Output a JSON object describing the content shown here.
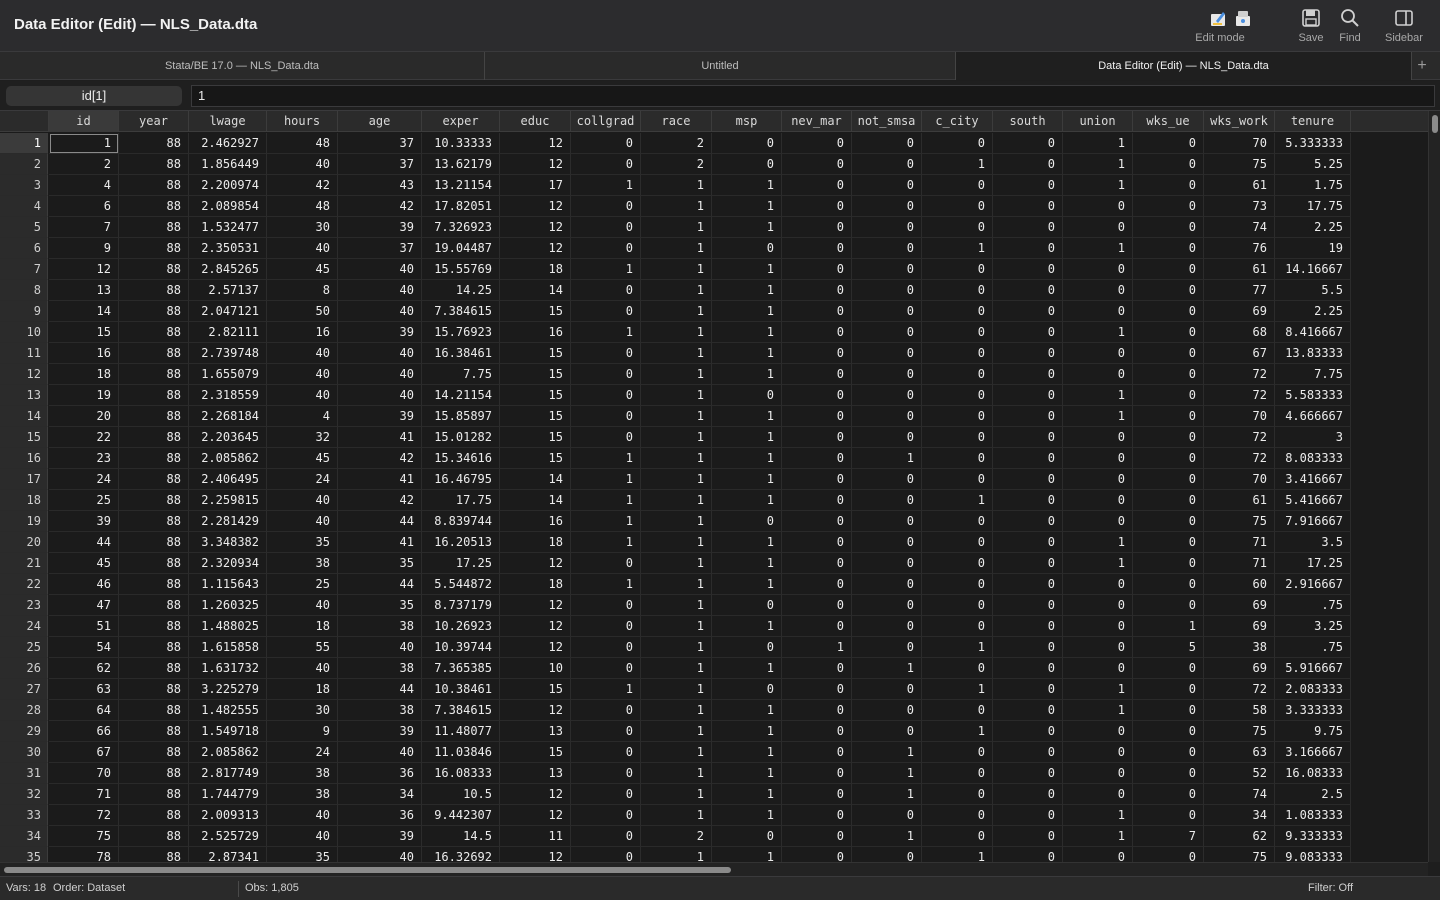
{
  "window": {
    "title": "Data Editor (Edit) — NLS_Data.dta"
  },
  "toolbar": {
    "edit_mode": "Edit mode",
    "save": "Save",
    "find": "Find",
    "sidebar": "Sidebar"
  },
  "tabs": [
    {
      "label": "Stata/BE 17.0 — NLS_Data.dta"
    },
    {
      "label": "Untitled"
    },
    {
      "label": "Data Editor (Edit) — NLS_Data.dta"
    }
  ],
  "add_tab": "+",
  "cellbar": {
    "ref": "id[1]",
    "value": "1"
  },
  "columns": [
    "id",
    "year",
    "lwage",
    "hours",
    "age",
    "exper",
    "educ",
    "collgrad",
    "race",
    "msp",
    "nev_mar",
    "not_smsa",
    "c_city",
    "south",
    "union",
    "wks_ue",
    "wks_work",
    "tenure"
  ],
  "rows": [
    [
      "1",
      "88",
      "2.462927",
      "48",
      "37",
      "10.33333",
      "12",
      "0",
      "2",
      "0",
      "0",
      "0",
      "0",
      "0",
      "1",
      "0",
      "70",
      "5.333333"
    ],
    [
      "2",
      "88",
      "1.856449",
      "40",
      "37",
      "13.62179",
      "12",
      "0",
      "2",
      "0",
      "0",
      "0",
      "1",
      "0",
      "1",
      "0",
      "75",
      "5.25"
    ],
    [
      "4",
      "88",
      "2.200974",
      "42",
      "43",
      "13.21154",
      "17",
      "1",
      "1",
      "1",
      "0",
      "0",
      "0",
      "0",
      "1",
      "0",
      "61",
      "1.75"
    ],
    [
      "6",
      "88",
      "2.089854",
      "48",
      "42",
      "17.82051",
      "12",
      "0",
      "1",
      "1",
      "0",
      "0",
      "0",
      "0",
      "0",
      "0",
      "73",
      "17.75"
    ],
    [
      "7",
      "88",
      "1.532477",
      "30",
      "39",
      "7.326923",
      "12",
      "0",
      "1",
      "1",
      "0",
      "0",
      "0",
      "0",
      "0",
      "0",
      "74",
      "2.25"
    ],
    [
      "9",
      "88",
      "2.350531",
      "40",
      "37",
      "19.04487",
      "12",
      "0",
      "1",
      "0",
      "0",
      "0",
      "1",
      "0",
      "1",
      "0",
      "76",
      "19"
    ],
    [
      "12",
      "88",
      "2.845265",
      "45",
      "40",
      "15.55769",
      "18",
      "1",
      "1",
      "1",
      "0",
      "0",
      "0",
      "0",
      "0",
      "0",
      "61",
      "14.16667"
    ],
    [
      "13",
      "88",
      "2.57137",
      "8",
      "40",
      "14.25",
      "14",
      "0",
      "1",
      "1",
      "0",
      "0",
      "0",
      "0",
      "0",
      "0",
      "77",
      "5.5"
    ],
    [
      "14",
      "88",
      "2.047121",
      "50",
      "40",
      "7.384615",
      "15",
      "0",
      "1",
      "1",
      "0",
      "0",
      "0",
      "0",
      "0",
      "0",
      "69",
      "2.25"
    ],
    [
      "15",
      "88",
      "2.82111",
      "16",
      "39",
      "15.76923",
      "16",
      "1",
      "1",
      "1",
      "0",
      "0",
      "0",
      "0",
      "1",
      "0",
      "68",
      "8.416667"
    ],
    [
      "16",
      "88",
      "2.739748",
      "40",
      "40",
      "16.38461",
      "15",
      "0",
      "1",
      "1",
      "0",
      "0",
      "0",
      "0",
      "0",
      "0",
      "67",
      "13.83333"
    ],
    [
      "18",
      "88",
      "1.655079",
      "40",
      "40",
      "7.75",
      "15",
      "0",
      "1",
      "1",
      "0",
      "0",
      "0",
      "0",
      "0",
      "0",
      "72",
      "7.75"
    ],
    [
      "19",
      "88",
      "2.318559",
      "40",
      "40",
      "14.21154",
      "15",
      "0",
      "1",
      "0",
      "0",
      "0",
      "0",
      "0",
      "1",
      "0",
      "72",
      "5.583333"
    ],
    [
      "20",
      "88",
      "2.268184",
      "4",
      "39",
      "15.85897",
      "15",
      "0",
      "1",
      "1",
      "0",
      "0",
      "0",
      "0",
      "1",
      "0",
      "70",
      "4.666667"
    ],
    [
      "22",
      "88",
      "2.203645",
      "32",
      "41",
      "15.01282",
      "15",
      "0",
      "1",
      "1",
      "0",
      "0",
      "0",
      "0",
      "0",
      "0",
      "72",
      "3"
    ],
    [
      "23",
      "88",
      "2.085862",
      "45",
      "42",
      "15.34616",
      "15",
      "1",
      "1",
      "1",
      "0",
      "1",
      "0",
      "0",
      "0",
      "0",
      "72",
      "8.083333"
    ],
    [
      "24",
      "88",
      "2.406495",
      "24",
      "41",
      "16.46795",
      "14",
      "1",
      "1",
      "1",
      "0",
      "0",
      "0",
      "0",
      "0",
      "0",
      "70",
      "3.416667"
    ],
    [
      "25",
      "88",
      "2.259815",
      "40",
      "42",
      "17.75",
      "14",
      "1",
      "1",
      "1",
      "0",
      "0",
      "1",
      "0",
      "0",
      "0",
      "61",
      "5.416667"
    ],
    [
      "39",
      "88",
      "2.281429",
      "40",
      "44",
      "8.839744",
      "16",
      "1",
      "1",
      "0",
      "0",
      "0",
      "0",
      "0",
      "0",
      "0",
      "75",
      "7.916667"
    ],
    [
      "44",
      "88",
      "3.348382",
      "35",
      "41",
      "16.20513",
      "18",
      "1",
      "1",
      "1",
      "0",
      "0",
      "0",
      "0",
      "1",
      "0",
      "71",
      "3.5"
    ],
    [
      "45",
      "88",
      "2.320934",
      "38",
      "35",
      "17.25",
      "12",
      "0",
      "1",
      "1",
      "0",
      "0",
      "0",
      "0",
      "1",
      "0",
      "71",
      "17.25"
    ],
    [
      "46",
      "88",
      "1.115643",
      "25",
      "44",
      "5.544872",
      "18",
      "1",
      "1",
      "1",
      "0",
      "0",
      "0",
      "0",
      "0",
      "0",
      "60",
      "2.916667"
    ],
    [
      "47",
      "88",
      "1.260325",
      "40",
      "35",
      "8.737179",
      "12",
      "0",
      "1",
      "0",
      "0",
      "0",
      "0",
      "0",
      "0",
      "0",
      "69",
      ".75"
    ],
    [
      "51",
      "88",
      "1.488025",
      "18",
      "38",
      "10.26923",
      "12",
      "0",
      "1",
      "1",
      "0",
      "0",
      "0",
      "0",
      "0",
      "1",
      "69",
      "3.25"
    ],
    [
      "54",
      "88",
      "1.615858",
      "55",
      "40",
      "10.39744",
      "12",
      "0",
      "1",
      "0",
      "1",
      "0",
      "1",
      "0",
      "0",
      "5",
      "38",
      ".75"
    ],
    [
      "62",
      "88",
      "1.631732",
      "40",
      "38",
      "7.365385",
      "10",
      "0",
      "1",
      "1",
      "0",
      "1",
      "0",
      "0",
      "0",
      "0",
      "69",
      "5.916667"
    ],
    [
      "63",
      "88",
      "3.225279",
      "18",
      "44",
      "10.38461",
      "15",
      "1",
      "1",
      "0",
      "0",
      "0",
      "1",
      "0",
      "1",
      "0",
      "72",
      "2.083333"
    ],
    [
      "64",
      "88",
      "1.482555",
      "30",
      "38",
      "7.384615",
      "12",
      "0",
      "1",
      "1",
      "0",
      "0",
      "0",
      "0",
      "1",
      "0",
      "58",
      "3.333333"
    ],
    [
      "66",
      "88",
      "1.549718",
      "9",
      "39",
      "11.48077",
      "13",
      "0",
      "1",
      "1",
      "0",
      "0",
      "1",
      "0",
      "0",
      "0",
      "75",
      "9.75"
    ],
    [
      "67",
      "88",
      "2.085862",
      "24",
      "40",
      "11.03846",
      "15",
      "0",
      "1",
      "1",
      "0",
      "1",
      "0",
      "0",
      "0",
      "0",
      "63",
      "3.166667"
    ],
    [
      "70",
      "88",
      "2.817749",
      "38",
      "36",
      "16.08333",
      "13",
      "0",
      "1",
      "1",
      "0",
      "1",
      "0",
      "0",
      "0",
      "0",
      "52",
      "16.08333"
    ],
    [
      "71",
      "88",
      "1.744779",
      "38",
      "34",
      "10.5",
      "12",
      "0",
      "1",
      "1",
      "0",
      "1",
      "0",
      "0",
      "0",
      "0",
      "74",
      "2.5"
    ],
    [
      "72",
      "88",
      "2.009313",
      "40",
      "36",
      "9.442307",
      "12",
      "0",
      "1",
      "1",
      "0",
      "0",
      "0",
      "0",
      "1",
      "0",
      "34",
      "1.083333"
    ],
    [
      "75",
      "88",
      "2.525729",
      "40",
      "39",
      "14.5",
      "11",
      "0",
      "2",
      "0",
      "0",
      "1",
      "0",
      "0",
      "1",
      "7",
      "62",
      "9.333333"
    ],
    [
      "78",
      "88",
      "2.87341",
      "35",
      "40",
      "16.32692",
      "12",
      "0",
      "1",
      "1",
      "0",
      "0",
      "1",
      "0",
      "0",
      "0",
      "75",
      "9.083333"
    ]
  ],
  "status": {
    "vars": "Vars: 18",
    "order": "Order: Dataset",
    "obs": "Obs: 1,805",
    "filter": "Filter: Off"
  }
}
